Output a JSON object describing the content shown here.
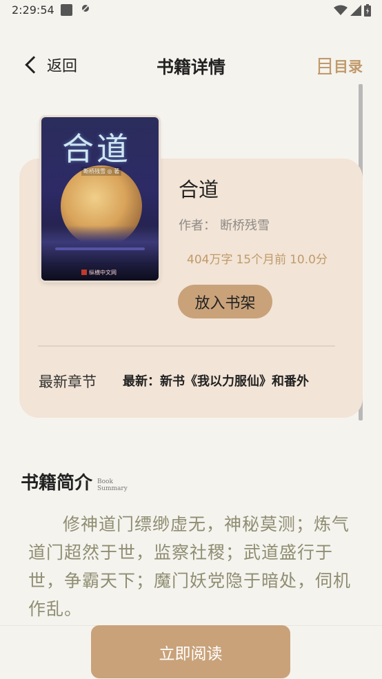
{
  "status": {
    "time": "2:29:54",
    "icons": [
      "square-icon",
      "notification-icon",
      "wifi-icon",
      "signal-icon",
      "battery-icon"
    ]
  },
  "nav": {
    "back_label": "返回",
    "title": "书籍详情",
    "toc_label": "目录"
  },
  "cover": {
    "title": "合道",
    "author": "断桥残雪 ◎ 著",
    "publisher": "纵横中文网"
  },
  "book": {
    "title": "合道",
    "author_label": "作者：",
    "author": "断桥残雪",
    "word_count": "404万字",
    "updated": "15个月前",
    "score": "10.0分",
    "shelf_button": "放入书架",
    "latest_label": "最新章节",
    "latest_chapter": "最新：新书《我以力服仙》和番外"
  },
  "summary": {
    "title": "书籍简介",
    "sub_line1": "Book",
    "sub_line2": "Summary",
    "text": "修神道门缥缈虚无，神秘莫测；炼气道门超然于世，监察社稷；武道盛行于世，争霸天下；魔门妖党隐于暗处，伺机作乱。"
  },
  "read_button": "立即阅读",
  "colors": {
    "accent": "#c09a6b",
    "button": "#c9a27a",
    "card": "#f2e4d6",
    "background": "#f5f3ee"
  }
}
